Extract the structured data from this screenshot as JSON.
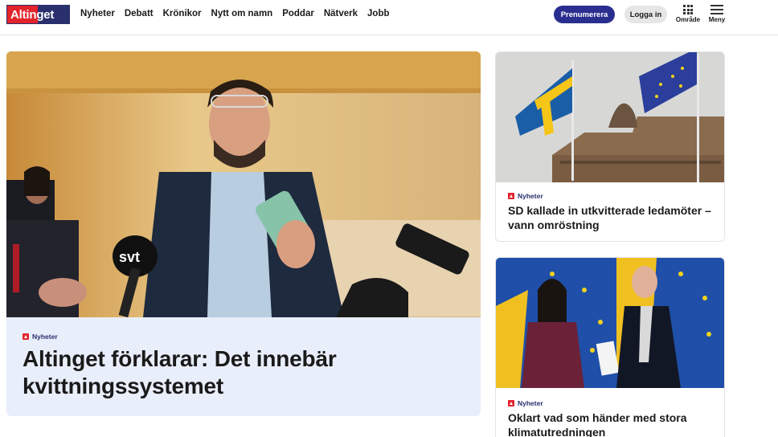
{
  "header": {
    "logo_text": "Altinget",
    "nav": [
      "Nyheter",
      "Debatt",
      "Krönikor",
      "Nytt om namn",
      "Poddar",
      "Nätverk",
      "Jobb"
    ],
    "subscribe_label": "Prenumerera",
    "login_label": "Logga in",
    "area_label": "Område",
    "menu_label": "Meny"
  },
  "main_article": {
    "tag": "Nyheter",
    "headline": "Altinget förklarar: Det innebär kvittningssystemet"
  },
  "side_articles": [
    {
      "tag": "Nyheter",
      "headline": "SD kallade in utkvitterade ledamöter – vann omröstning"
    },
    {
      "tag": "Nyheter",
      "headline": "Oklart vad som händer med stora klimatutredningen"
    }
  ],
  "colors": {
    "brand_red": "#e3242b",
    "brand_navy": "#2a2f6e",
    "subscribe_blue": "#2a2f8f",
    "main_card_bg": "#e9eefb"
  }
}
